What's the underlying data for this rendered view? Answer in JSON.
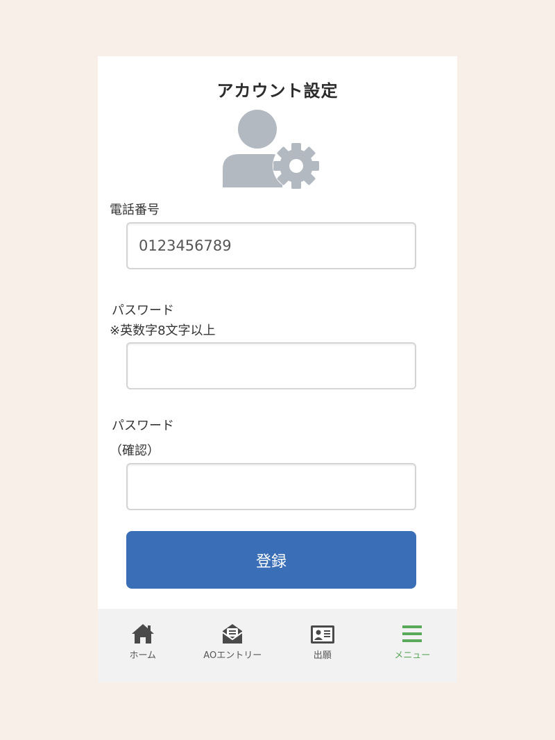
{
  "page": {
    "title": "アカウント設定"
  },
  "form": {
    "phone": {
      "label": "電話番号",
      "value": "0123456789"
    },
    "password": {
      "label": "パスワード",
      "note": "※英数字8文字以上",
      "value": ""
    },
    "password_confirm": {
      "label": "パスワード",
      "note": "（確認）",
      "value": ""
    },
    "submit_label": "登録"
  },
  "tabbar": {
    "items": [
      {
        "label": "ホーム",
        "icon": "home-icon"
      },
      {
        "label": "AOエントリー",
        "icon": "mail-entry-icon"
      },
      {
        "label": "出願",
        "icon": "id-card-icon"
      },
      {
        "label": "メニュー",
        "icon": "hamburger-menu-icon"
      }
    ],
    "active_index": 3
  },
  "colors": {
    "background": "#f7efe8",
    "primary_button": "#3a6fb7",
    "active_tab": "#5aa85a",
    "avatar_gray": "#b2b9c1"
  }
}
